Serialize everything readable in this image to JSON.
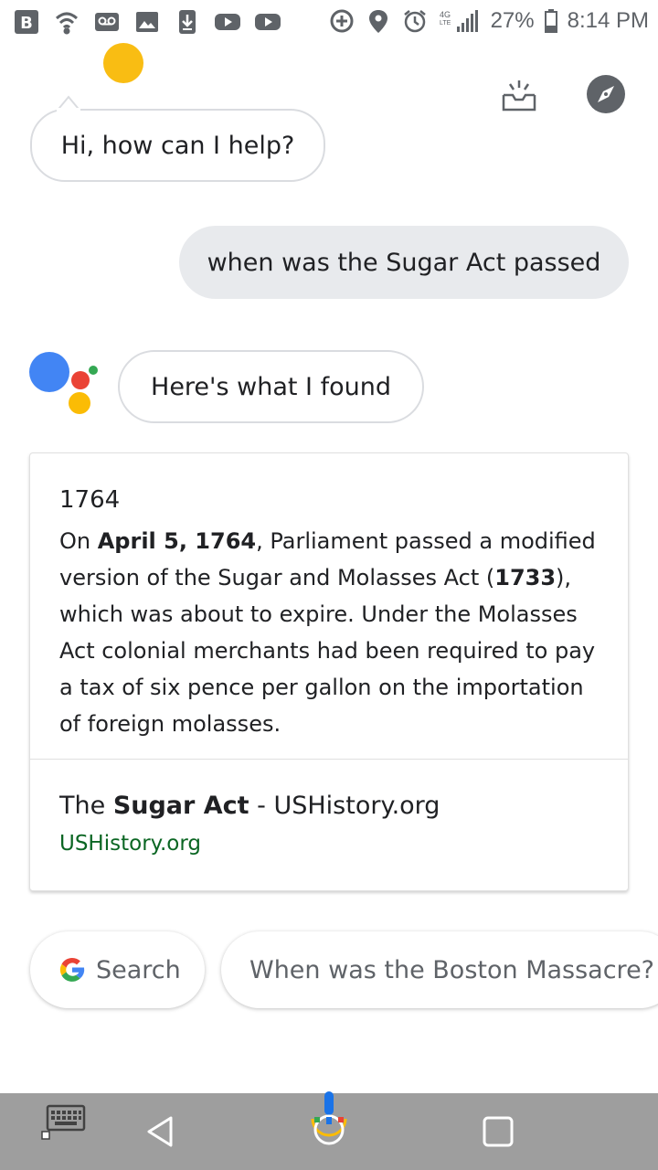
{
  "status_bar": {
    "battery": "27%",
    "time": "8:14 PM",
    "network": "4G LTE",
    "icons": [
      "b-app-icon",
      "wifi-hotspot-icon",
      "voicemail-icon",
      "image-icon",
      "download-icon",
      "youtube-icon",
      "youtube-icon",
      "data-saver-icon",
      "location-icon",
      "alarm-icon",
      "signal-icon",
      "battery-icon"
    ]
  },
  "header": {
    "icons": [
      "snapshot-inbox-icon",
      "explore-compass-icon"
    ]
  },
  "conversation": {
    "greeting": "Hi, how can I help?",
    "user_query": "when was the Sugar Act passed",
    "response": "Here's what I found"
  },
  "answer_card": {
    "year": "1764",
    "body_prefix": "On ",
    "body_date": "April 5, 1764",
    "body_mid": ", Parliament passed a modified version of the Sugar and Molasses Act (",
    "body_year": "1733",
    "body_rest": "), which was about to expire. Under the Molasses Act colonial merchants had been required to pay a tax of six pence per gallon on the importation of foreign molasses.",
    "source_title_prefix": "The ",
    "source_title_bold": "Sugar Act",
    "source_title_suffix": " - USHistory.org",
    "source_url": "USHistory.org"
  },
  "suggestions": {
    "search_label": "Search",
    "follow_up": "When was the Boston Massacre?"
  },
  "colors": {
    "sun": "#f9bd13",
    "google_blue": "#4285f4",
    "google_red": "#ea4335",
    "google_yellow": "#fbbc05",
    "google_green": "#34a853",
    "source_green": "#0b6623",
    "nav_bg": "#9e9e9e"
  }
}
